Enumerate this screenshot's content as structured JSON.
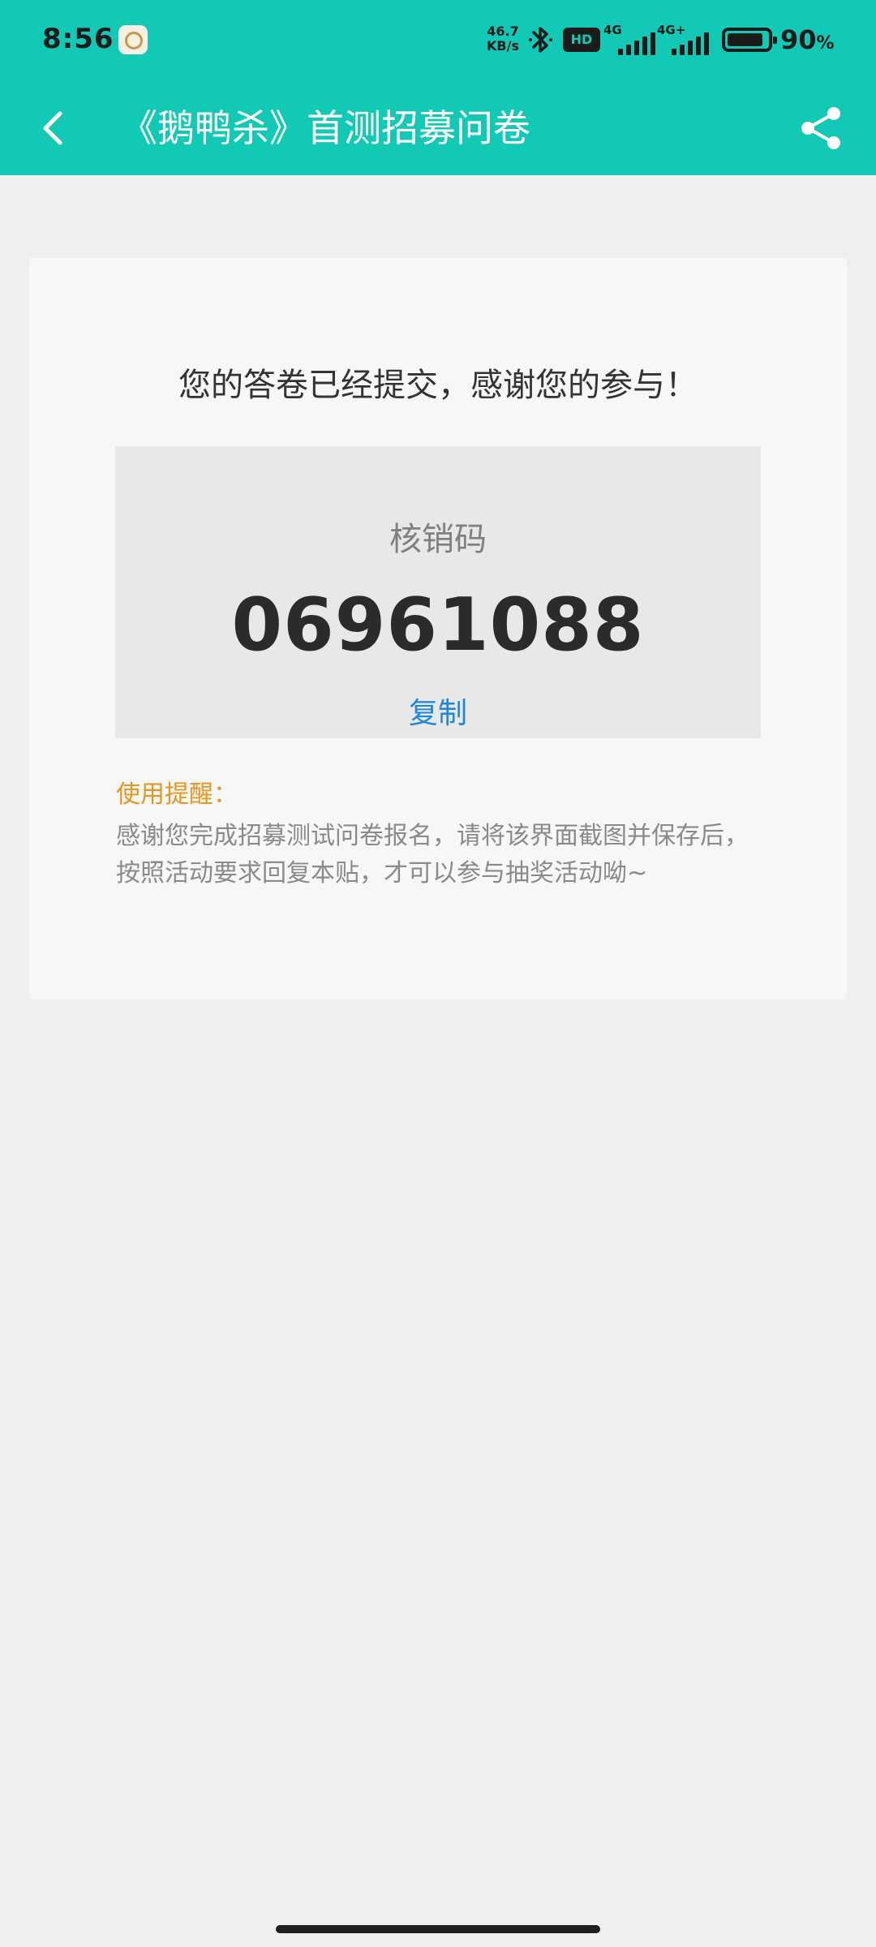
{
  "status_bar": {
    "time": "8:56",
    "network_speed_value": "46.7",
    "network_speed_unit": "KB/s",
    "hd_badge": "HD",
    "signal_1_label": "4G",
    "signal_2_label": "4G+",
    "battery_level": 0.9,
    "battery_percent": "90",
    "battery_unit": "%"
  },
  "nav": {
    "title": "《鹅鸭杀》首测招募问卷",
    "back_icon": "chevron-left-icon",
    "share_icon": "share-icon"
  },
  "card": {
    "message": "您的答卷已经提交，感谢您的参与！",
    "code_label": "核销码",
    "code_value": "06961088",
    "copy_label": "复制",
    "tip_title": "使用提醒：",
    "tip_body": "感谢您完成招募测试问卷报名，请将该界面截图并保存后，按照活动要求回复本贴，才可以参与抽奖活动呦~"
  },
  "colors": {
    "header": "#12c9b5",
    "copy_link": "#1f86d8",
    "tip_title": "#e6951e"
  }
}
